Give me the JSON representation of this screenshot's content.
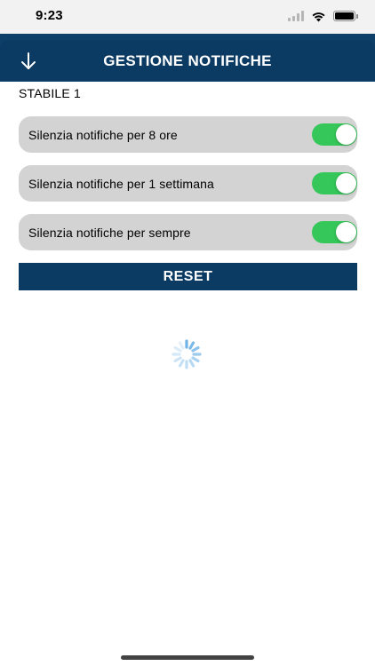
{
  "status_bar": {
    "time": "9:23",
    "icons": [
      "signal-icon",
      "wifi-icon",
      "battery-icon"
    ]
  },
  "header": {
    "title": "GESTIONE NOTIFICHE",
    "back_icon": "arrow-down-icon"
  },
  "section": {
    "title": "STABILE 1"
  },
  "options": [
    {
      "label": "Silenzia notifiche per 8 ore",
      "enabled": true
    },
    {
      "label": "Silenzia notifiche per 1 settimana",
      "enabled": true
    },
    {
      "label": "Silenzia notifiche per sempre",
      "enabled": true
    }
  ],
  "reset": {
    "label": "RESET"
  },
  "colors": {
    "primary": "#0b3a63",
    "toggle_on": "#35c759",
    "row_background": "#d3d3d3",
    "spinner": "#6fb3e6"
  }
}
